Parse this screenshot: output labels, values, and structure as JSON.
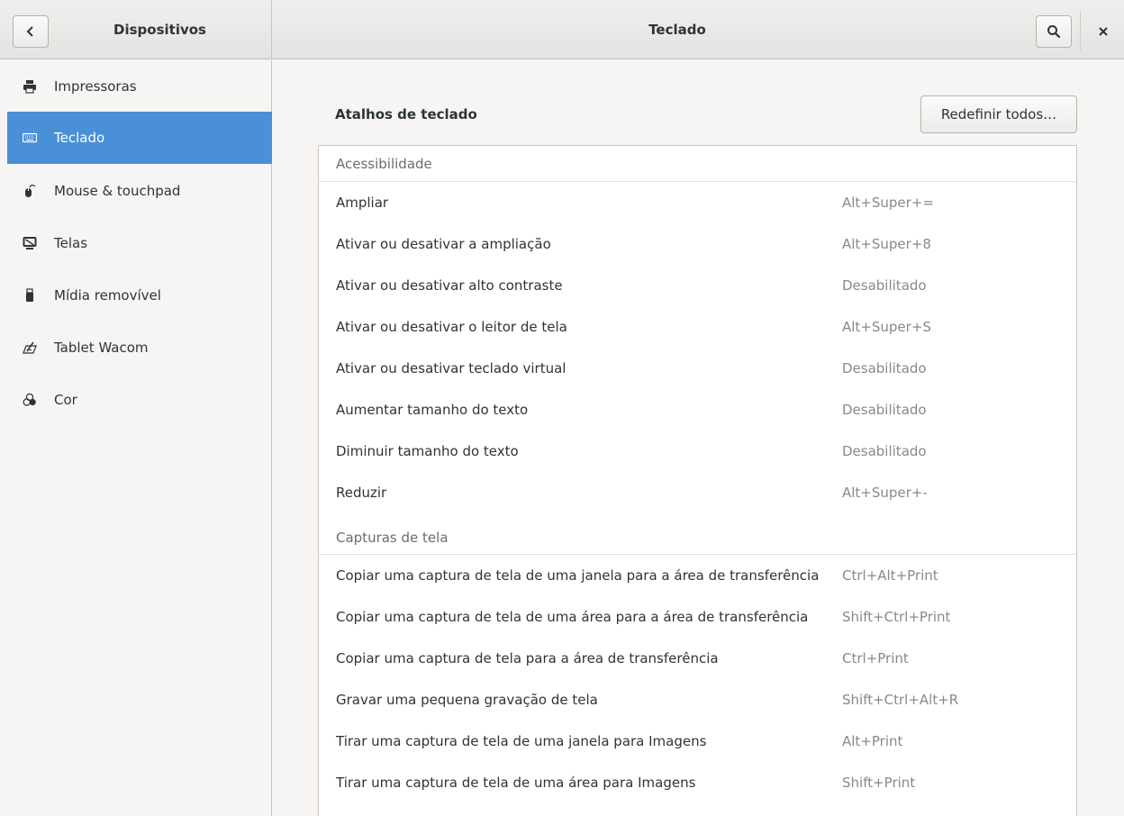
{
  "header": {
    "back_label": "Dispositivos",
    "title": "Teclado",
    "search_icon": "search-icon",
    "close_icon": "close-icon"
  },
  "sidebar": {
    "items": [
      {
        "label": "Impressoras",
        "icon": "printer-icon"
      },
      {
        "label": "Teclado",
        "icon": "keyboard-icon",
        "active": true
      },
      {
        "label": "Mouse & touchpad",
        "icon": "mouse-icon"
      },
      {
        "label": "Telas",
        "icon": "display-icon"
      },
      {
        "label": "Mídia removível",
        "icon": "usb-drive-icon"
      },
      {
        "label": "Tablet Wacom",
        "icon": "tablet-icon"
      },
      {
        "label": "Cor",
        "icon": "color-icon"
      }
    ]
  },
  "main": {
    "section_title": "Atalhos de teclado",
    "reset_label": "Redefinir todos…",
    "groups": [
      {
        "title": "Acessibilidade",
        "rows": [
          {
            "name": "Ampliar",
            "accel": "Alt+Super+="
          },
          {
            "name": "Ativar ou desativar a ampliação",
            "accel": "Alt+Super+8"
          },
          {
            "name": "Ativar ou desativar alto contraste",
            "accel": "Desabilitado"
          },
          {
            "name": "Ativar ou desativar o leitor de tela",
            "accel": "Alt+Super+S"
          },
          {
            "name": "Ativar ou desativar teclado virtual",
            "accel": "Desabilitado"
          },
          {
            "name": "Aumentar tamanho do texto",
            "accel": "Desabilitado"
          },
          {
            "name": "Diminuir tamanho do texto",
            "accel": "Desabilitado"
          },
          {
            "name": "Reduzir",
            "accel": "Alt+Super+-"
          }
        ]
      },
      {
        "title": "Capturas de tela",
        "rows": [
          {
            "name": "Copiar uma captura de tela de uma janela para a área de transferência",
            "accel": "Ctrl+Alt+Print"
          },
          {
            "name": "Copiar uma captura de tela de uma área para a área de transferência",
            "accel": "Shift+Ctrl+Print"
          },
          {
            "name": "Copiar uma captura de tela para a área de transferência",
            "accel": "Ctrl+Print"
          },
          {
            "name": "Gravar uma pequena gravação de tela",
            "accel": "Shift+Ctrl+Alt+R"
          },
          {
            "name": "Tirar uma captura de tela de uma janela para Imagens",
            "accel": "Alt+Print"
          },
          {
            "name": "Tirar uma captura de tela de uma área para Imagens",
            "accel": "Shift+Print"
          }
        ]
      }
    ]
  },
  "colors": {
    "accent": "#4a90d9",
    "text": "#2e3436",
    "dim_text": "#888a85"
  }
}
